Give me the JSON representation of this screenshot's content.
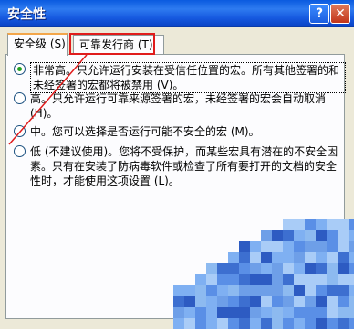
{
  "window": {
    "title": "安全性"
  },
  "tabs": [
    {
      "label": "安全级 (S)"
    },
    {
      "label": "可靠发行商 (T)"
    }
  ],
  "options": [
    {
      "text": "非常高。只允许运行安装在受信任位置的宏。所有其他签署的和未经签署的宏都将被禁用 (V)。",
      "checked": true
    },
    {
      "text": "高。只允许运行可靠来源签署的宏，未经签署的宏会自动取消 (H)。",
      "checked": false
    },
    {
      "text": "中。您可以选择是否运行可能不安全的宏 (M)。",
      "checked": false
    },
    {
      "text": "低 (不建议使用)。您将不受保护，而某些宏具有潜在的不安全因素。只有在安装了防病毒软件或检查了所有要打开的文档的安全性时，才能使用这项设置 (L)。",
      "checked": false
    }
  ],
  "colors": {
    "highlight_border": "#E01C1C",
    "titlebar": "#0A5ADF"
  }
}
